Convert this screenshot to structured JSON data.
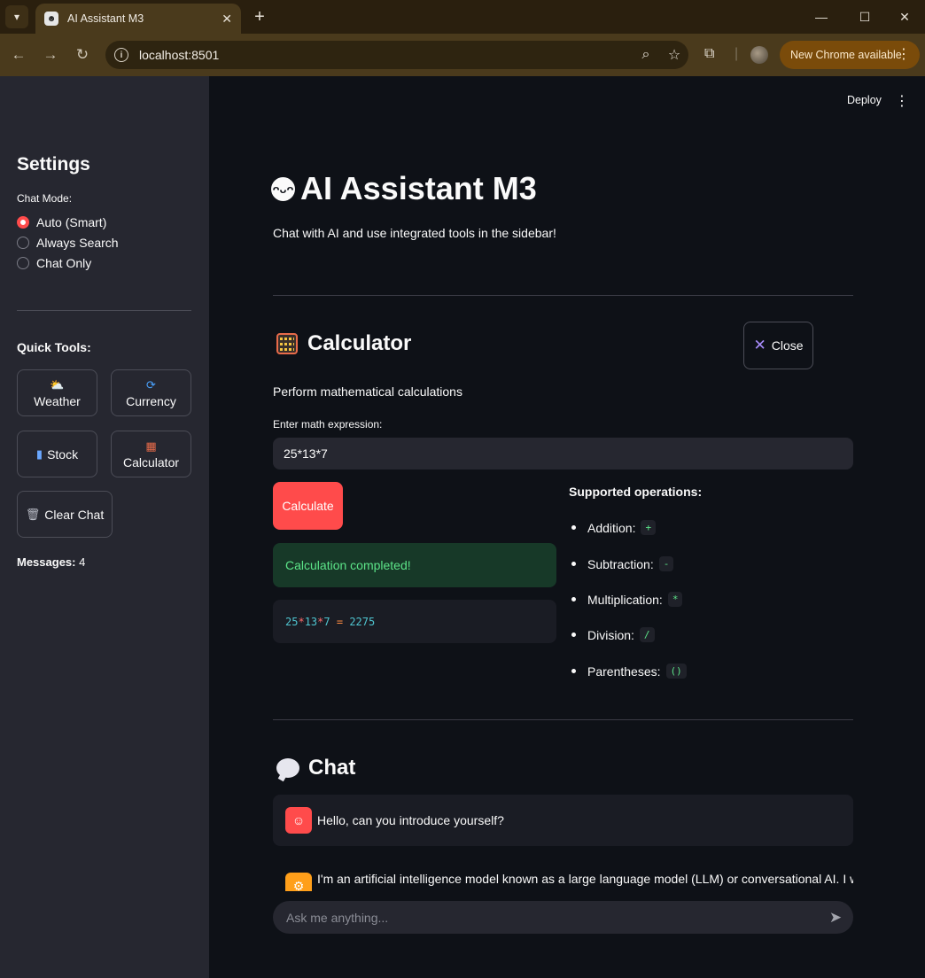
{
  "browser": {
    "tab_title": "AI Assistant M3",
    "url": "localhost:8501",
    "update_label": "New Chrome available"
  },
  "sidebar": {
    "title": "Settings",
    "chat_mode_label": "Chat Mode:",
    "modes": [
      {
        "label": "Auto (Smart)",
        "selected": true
      },
      {
        "label": "Always Search",
        "selected": false
      },
      {
        "label": "Chat Only",
        "selected": false
      }
    ],
    "quick_tools_label": "Quick Tools:",
    "tools": [
      {
        "label": "Weather",
        "icon": "sun-behind-cloud-icon"
      },
      {
        "label": "Currency",
        "icon": "currency-exchange-icon"
      },
      {
        "label": "Stock",
        "icon": "bar-chart-icon"
      },
      {
        "label": "Calculator",
        "icon": "abacus-icon"
      },
      {
        "label": "Clear Chat",
        "icon": "wastebasket-icon"
      }
    ],
    "messages_label": "Messages:",
    "messages_count": "4"
  },
  "header": {
    "deploy_label": "Deploy"
  },
  "main": {
    "title": "AI Assistant M3",
    "subtitle": "Chat with AI and use integrated tools in the sidebar!"
  },
  "calculator": {
    "heading": "Calculator",
    "close_label": "Close",
    "description": "Perform mathematical calculations",
    "input_label": "Enter math expression:",
    "input_value": "25*13*7",
    "calculate_label": "Calculate",
    "success_message": "Calculation completed!",
    "result": {
      "n1": "25",
      "op1": "*",
      "n2": "13",
      "op2": "*",
      "n3": "7",
      "eq": "=",
      "answer": "2275"
    },
    "ops_title": "Supported operations:",
    "operations": [
      {
        "label": "Addition:",
        "symbol": "+"
      },
      {
        "label": "Subtraction:",
        "symbol": "-"
      },
      {
        "label": "Multiplication:",
        "symbol": "*"
      },
      {
        "label": "Division:",
        "symbol": "/"
      },
      {
        "label": "Parentheses:",
        "symbol": "()"
      }
    ]
  },
  "chat": {
    "heading": "Chat",
    "user_message": "Hello, can you introduce yourself?",
    "assistant_message": "I'm an artificial intelligence model known as a large language model (LLM) or conversational AI. I was",
    "input_placeholder": "Ask me anything..."
  },
  "colors": {
    "accent": "#ff4b4b",
    "sidebar_bg": "#262730",
    "main_bg": "#0e1117",
    "success_bg": "#173928",
    "success_text": "#5ce488"
  }
}
